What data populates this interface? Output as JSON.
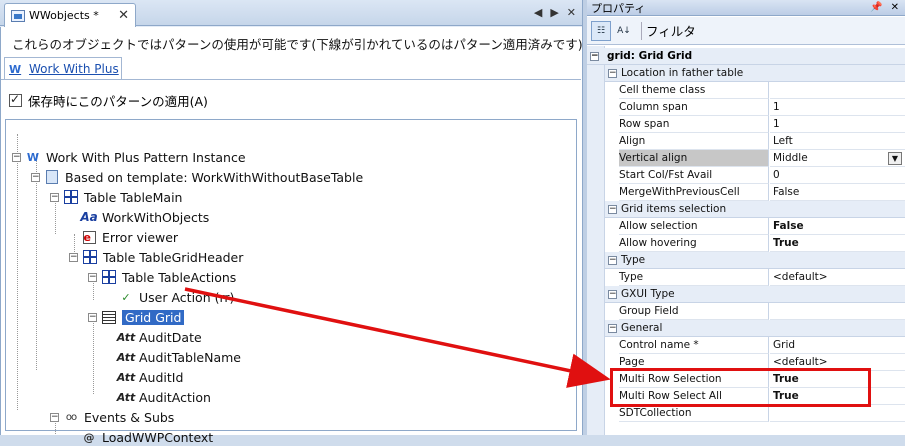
{
  "doc_tab": {
    "title": "WWobjects *",
    "close": "✕"
  },
  "window_controls": [
    "◀",
    "▶",
    "✕"
  ],
  "description": "これらのオブジェクトではパターンの使用が可能です(下線が引かれているのはパターン適用済みです)",
  "pattern_tab": {
    "label": "Work With Plus",
    "icon": "W"
  },
  "apply_on_save": {
    "label": "保存時にこのパターンの適用(A)",
    "checked": true
  },
  "tree": {
    "root": "Work With Plus Pattern Instance",
    "template": "Based on template: WorkWithWithoutBaseTable",
    "table_main": "Table TableMain",
    "text_block": "WorkWithObjects",
    "error_viewer": "Error viewer",
    "grid_header": "Table TableGridHeader",
    "table_actions": "Table TableActions",
    "user_action": "User Action (rr)",
    "grid": "Grid Grid",
    "attributes": [
      "AuditDate",
      "AuditTableName",
      "AuditId",
      "AuditAction"
    ],
    "events": "Events & Subs",
    "load_context": "LoadWWPContext"
  },
  "props": {
    "panel_title": "プロパティ",
    "filter_label": "フィルタ",
    "root_title": "grid: Grid Grid",
    "categories": [
      {
        "title": "Location in father table",
        "rows": [
          {
            "key": "Cell theme class",
            "value": ""
          },
          {
            "key": "Column span",
            "value": "1"
          },
          {
            "key": "Row span",
            "value": "1"
          },
          {
            "key": "Align",
            "value": "Left"
          },
          {
            "key": "Vertical align",
            "value": "Middle"
          },
          {
            "key": "Start Col/Fst Avail",
            "value": "0"
          },
          {
            "key": "MergeWithPreviousCell",
            "value": "False"
          }
        ]
      },
      {
        "title": "Grid items selection",
        "rows": [
          {
            "key": "Allow selection",
            "value": "False"
          },
          {
            "key": "Allow hovering",
            "value": "True"
          }
        ]
      },
      {
        "title": "Type",
        "rows": [
          {
            "key": "Type",
            "value": "<default>"
          }
        ]
      },
      {
        "title": "GXUI Type",
        "rows": [
          {
            "key": "Group Field",
            "value": ""
          }
        ]
      },
      {
        "title": "General",
        "rows": [
          {
            "key": "Control name *",
            "value": "Grid"
          },
          {
            "key": "Page",
            "value": "<default>"
          },
          {
            "key": "Multi Row Selection",
            "value": "True"
          },
          {
            "key": "Multi Row Select All",
            "value": "True"
          },
          {
            "key": "SDTCollection",
            "value": ""
          }
        ]
      }
    ]
  },
  "colors": {
    "selection": "#316ac5",
    "annotation": "#e01010"
  }
}
